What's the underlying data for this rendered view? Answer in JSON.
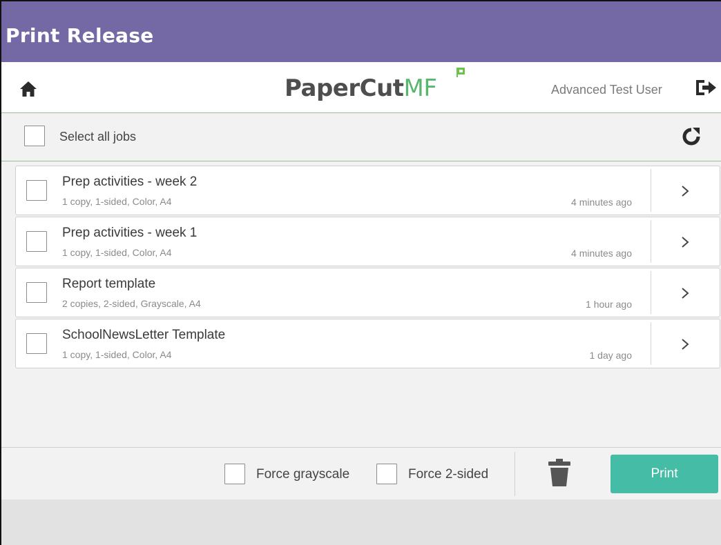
{
  "app": {
    "title": "Print Release"
  },
  "header": {
    "home_icon": "home-icon",
    "logo": {
      "part1": "PaperCut",
      "part2": "MF"
    },
    "user_name": "Advanced Test User",
    "logout_icon": "logout-icon"
  },
  "select_bar": {
    "label": "Select all jobs",
    "checked": false,
    "refresh_icon": "refresh-icon"
  },
  "jobs": [
    {
      "name": "Prep activities - week 2",
      "details": "1 copy, 1-sided, Color, A4",
      "time": "4 minutes ago",
      "checked": false
    },
    {
      "name": "Prep activities - week 1",
      "details": "1 copy, 1-sided, Color, A4",
      "time": "4 minutes ago",
      "checked": false
    },
    {
      "name": "Report template",
      "details": "2 copies, 2-sided, Grayscale, A4",
      "time": "1 hour ago",
      "checked": false
    },
    {
      "name": "SchoolNewsLetter Template",
      "details": "1 copy, 1-sided, Color, A4",
      "time": "1 day ago",
      "checked": false
    }
  ],
  "footer": {
    "force_grayscale_label": "Force grayscale",
    "force_2sided_label": "Force 2-sided",
    "trash_icon": "trash-icon",
    "print_label": "Print"
  },
  "colors": {
    "title_bar": "#7469a4",
    "accent_green": "#59b76d",
    "print_button": "#45bca5",
    "panel_bg": "#f2f2f2"
  }
}
